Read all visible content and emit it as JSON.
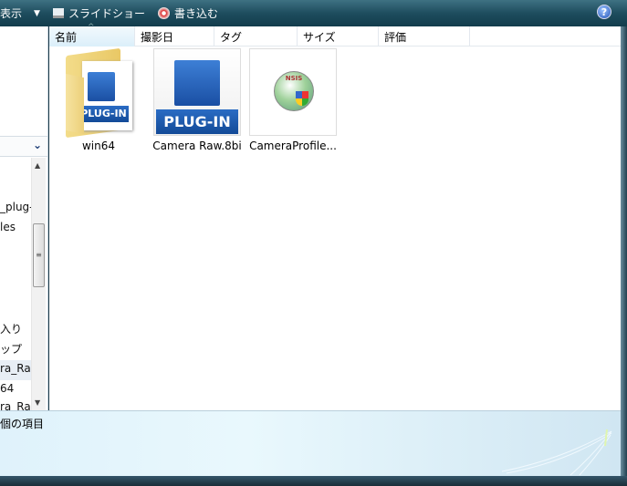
{
  "toolbar": {
    "view": "表示",
    "slideshow": "スライドショー",
    "burn": "書き込む",
    "help": "?"
  },
  "columns": [
    "名前",
    "撮影日",
    "タグ",
    "サイズ",
    "評価"
  ],
  "files": [
    {
      "name": "win64",
      "type": "folder",
      "badge": "PLUG-IN"
    },
    {
      "name": "Camera Raw.8bi",
      "type": "plugin",
      "badge": "PLUG-IN"
    },
    {
      "name": "CameraProfile...",
      "type": "installer",
      "badge": "NSIS"
    }
  ],
  "nav": [
    "_plug-",
    "les",
    "入り",
    "ップ",
    "ra_Ra",
    "64",
    "ra_Ra"
  ],
  "details": {
    "count_text": "個の項目"
  }
}
